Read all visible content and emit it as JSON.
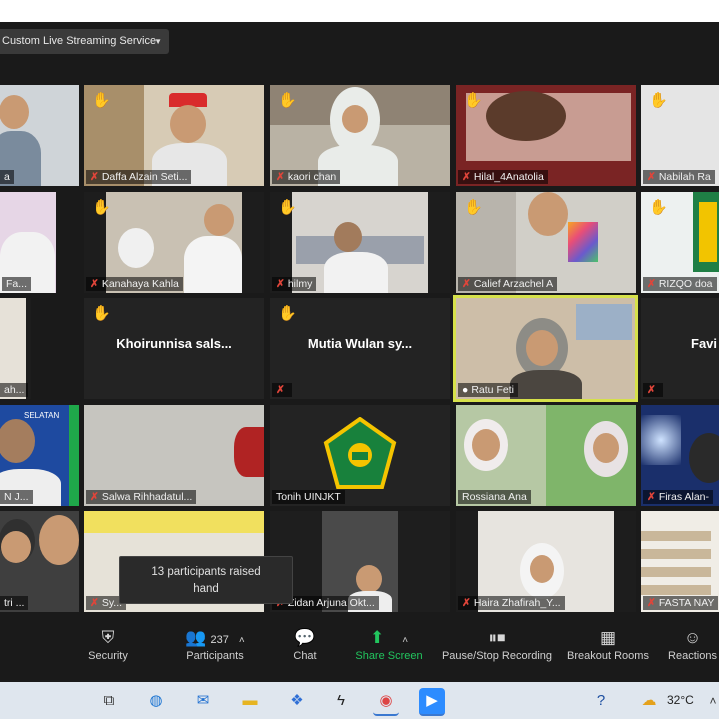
{
  "stream_menu": {
    "label": "Custom Live Streaming Service"
  },
  "tiles": [
    {
      "name": "a",
      "hand": false
    },
    {
      "name": "Daffa Alzain Seti...",
      "hand": true
    },
    {
      "name": "kaori chan",
      "hand": true
    },
    {
      "name": "Hilal_4Anatolia",
      "hand": true
    },
    {
      "name": "Nabilah Ra",
      "hand": true
    },
    {
      "name": "Fa...",
      "hand": false
    },
    {
      "name": "Kanahaya Kahla",
      "hand": true
    },
    {
      "name": "hilmy",
      "hand": true
    },
    {
      "name": "Calief Arzachel A",
      "hand": true
    },
    {
      "name": "RIZQO doa",
      "hand": true
    },
    {
      "name": "ah...",
      "hand": false
    },
    {
      "name": "",
      "hand": true,
      "big": "Khoirunnisa sals..."
    },
    {
      "name": "",
      "hand": true,
      "big": "Mutia Wulan sy..."
    },
    {
      "name": "Ratu Feti",
      "hand": false
    },
    {
      "name": "",
      "hand": false,
      "big": "Favi"
    },
    {
      "name": "N J...",
      "hand": false
    },
    {
      "name": "Salwa Rihhadatul...",
      "hand": false
    },
    {
      "name": "Tonih UINJKT",
      "hand": false
    },
    {
      "name": "Rossiana Ana",
      "hand": false
    },
    {
      "name": "Firas Alan-",
      "hand": false
    },
    {
      "name": "tri ...",
      "hand": false
    },
    {
      "name": "Sy...",
      "hand": false
    },
    {
      "name": "Zidan Arjuna Okt...",
      "hand": false
    },
    {
      "name": "Haira Zhafirah_Y...",
      "hand": false
    },
    {
      "name": "FASTA NAY",
      "hand": false
    }
  ],
  "tile6_banner": "SELATAN",
  "tooltip": {
    "line1": "13 participants raised",
    "line2": "hand"
  },
  "toolbar": {
    "security": "Security",
    "participants": "Participants",
    "participant_count": "237",
    "chat": "Chat",
    "share": "Share Screen",
    "record": "Pause/Stop Recording",
    "breakout": "Breakout Rooms",
    "reactions": "Reactions"
  },
  "taskbar": {
    "temperature": "32°C"
  },
  "colors": {
    "active_speaker": "#d6e14a",
    "share_green": "#22c55e",
    "muted_red": "#e0453a",
    "hand_yellow": "#f4c21c"
  }
}
